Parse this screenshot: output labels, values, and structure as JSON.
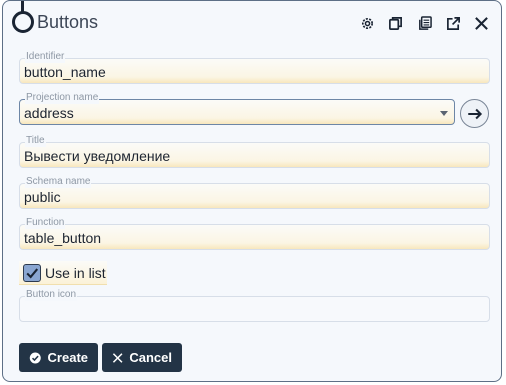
{
  "dialog": {
    "title": "Buttons",
    "header_icons": [
      "gear-icon",
      "copy-icon",
      "duplicate-icon",
      "open-external-icon",
      "close-icon"
    ]
  },
  "fields": {
    "identifier": {
      "label": "Identifier",
      "value": "button_name"
    },
    "projection_name": {
      "label": "Projection name",
      "value": "address"
    },
    "title": {
      "label": "Title",
      "value": "Вывести уведомление"
    },
    "schema_name": {
      "label": "Schema name",
      "value": "public"
    },
    "function": {
      "label": "Function",
      "value": "table_button"
    },
    "button_icon": {
      "label": "Button icon",
      "value": ""
    }
  },
  "use_in_list": {
    "label": "Use in list",
    "checked": true
  },
  "actions": {
    "create_label": "Create",
    "cancel_label": "Cancel"
  },
  "colors": {
    "button_bg": "#233446",
    "checkbox_fill": "#8aa6d1",
    "field_highlight": "#f8e7bd"
  }
}
